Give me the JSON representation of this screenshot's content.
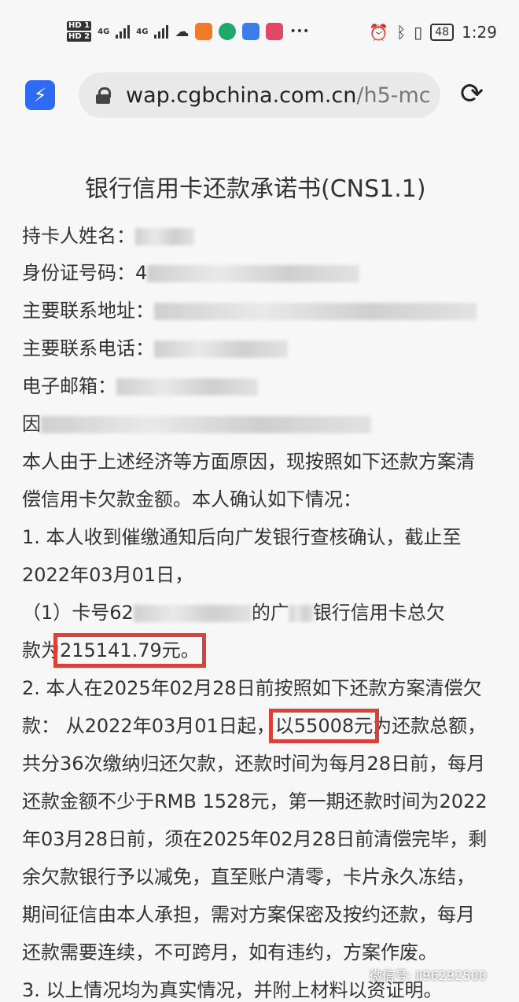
{
  "status_bar": {
    "sim1": "HD 1",
    "sim2": "HD 2",
    "net1": "4G",
    "net2": "4G",
    "battery": "48",
    "time": "1:29"
  },
  "browser": {
    "url_main": "wap.cgbchina.com.cn",
    "url_rest": "/h5-mc"
  },
  "doc": {
    "title": "银行信用卡还款承诺书(CNS1.1)",
    "fields": [
      {
        "label": "持卡人姓名："
      },
      {
        "label": "身份证号码：",
        "prefix": "4"
      },
      {
        "label": "主要联系地址："
      },
      {
        "label": "主要联系电话："
      },
      {
        "label": "电子邮箱："
      },
      {
        "label": "因"
      }
    ],
    "para1_l1": "本人由于上述经济等方面原因，现按照如下还款方案清",
    "para1_l2": "偿信用卡欠款金额。本人确认如下情况：",
    "p1_l1": "1. 本人收到催缴通知后向广发银行查核确认，截止至",
    "p1_l2": "2022年03月01日，",
    "p1_l3a": "（1）卡号62",
    "p1_l3b": "的广",
    "p1_l3c": "银行信用卡总欠",
    "p1_l4a": "款为",
    "p1_amount": "215141.79元。",
    "p2_l1": "2. 本人在2025年02月28日前按照如下还款方案清偿欠",
    "p2_l2a": "款： 从2022年03月01日起，",
    "p2_amount": "以55008元",
    "p2_l2b": "为还款总额，",
    "p2_l3": "共分36次缴纳归还欠款，还款时间为每月28日前，每月",
    "p2_l4": "还款金额不少于RMB 1528元，第一期还款时间为2022",
    "p2_l5": "年03月28日前，须在2025年02月28日前清偿完毕，剩",
    "p2_l6": "余欠款银行予以减免，直至账户清零，卡片永久冻结，",
    "p2_l7": "期间征信由本人承担，需对方案保密及按约还款，每月",
    "p2_l8": "还款需要连续，不可跨月，如有违约，方案作废。",
    "p3_l1": "3. 以上情况均为真实情况，并附上材料以资证明。"
  },
  "watermark": "微信号: li96292500"
}
